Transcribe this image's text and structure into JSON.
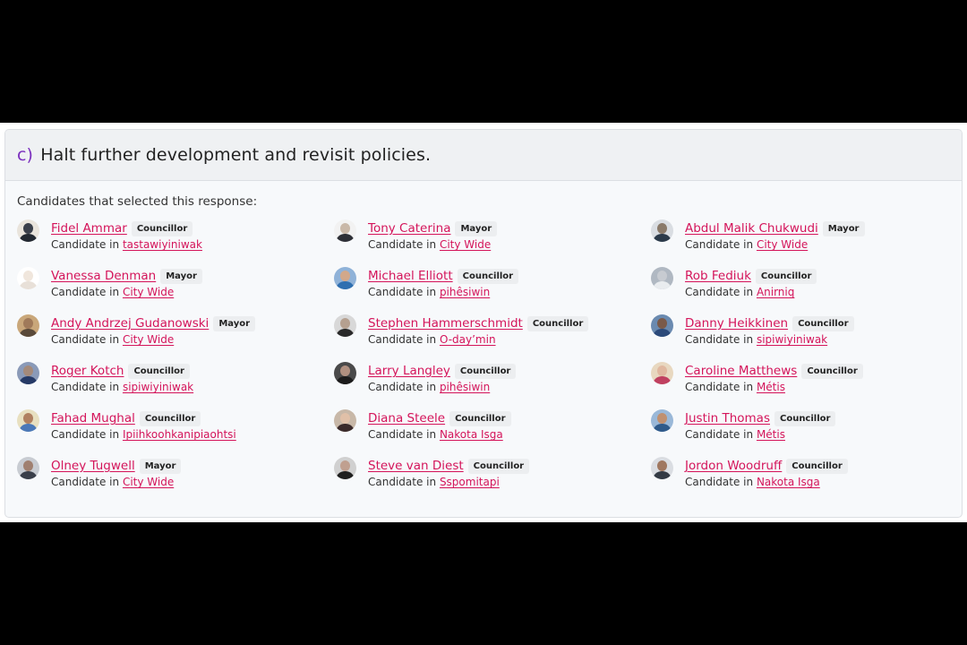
{
  "question": {
    "option_letter": "c)",
    "text": "Halt further development and revisit policies."
  },
  "section_label": "Candidates that selected this response:",
  "candidate_prefix": "Candidate in",
  "colors": {
    "link": "#d4145a",
    "option_letter": "#7b2fbe"
  },
  "candidates": [
    {
      "name": "Fidel Ammar",
      "role": "Councillor",
      "district": "tastawiyiniwak"
    },
    {
      "name": "Tony Caterina",
      "role": "Mayor",
      "district": "City Wide"
    },
    {
      "name": "Abdul Malik Chukwudi",
      "role": "Mayor",
      "district": "City Wide"
    },
    {
      "name": "Vanessa Denman",
      "role": "Mayor",
      "district": "City Wide"
    },
    {
      "name": "Michael Elliott",
      "role": "Councillor",
      "district": "pihêsiwin"
    },
    {
      "name": "Rob Fediuk",
      "role": "Councillor",
      "district": "Anirniq"
    },
    {
      "name": "Andy Andrzej Gudanowski",
      "role": "Mayor",
      "district": "City Wide"
    },
    {
      "name": "Stephen Hammerschmidt",
      "role": "Councillor",
      "district": "O-day’min"
    },
    {
      "name": "Danny Heikkinen",
      "role": "Councillor",
      "district": "sipiwiyiniwak"
    },
    {
      "name": "Roger Kotch",
      "role": "Councillor",
      "district": "sipiwiyiniwak"
    },
    {
      "name": "Larry Langley",
      "role": "Councillor",
      "district": "pihêsiwin"
    },
    {
      "name": "Caroline Matthews",
      "role": "Councillor",
      "district": "Métis"
    },
    {
      "name": "Fahad Mughal",
      "role": "Councillor",
      "district": "Ipiihkoohkanipiaohtsi"
    },
    {
      "name": "Diana Steele",
      "role": "Councillor",
      "district": "Nakota Isga"
    },
    {
      "name": "Justin Thomas",
      "role": "Councillor",
      "district": "Métis"
    },
    {
      "name": "Olney Tugwell",
      "role": "Mayor",
      "district": "City Wide"
    },
    {
      "name": "Steve van Diest",
      "role": "Councillor",
      "district": "Sspomitapi"
    },
    {
      "name": "Jordon Woodruff",
      "role": "Councillor",
      "district": "Nakota Isga"
    }
  ]
}
